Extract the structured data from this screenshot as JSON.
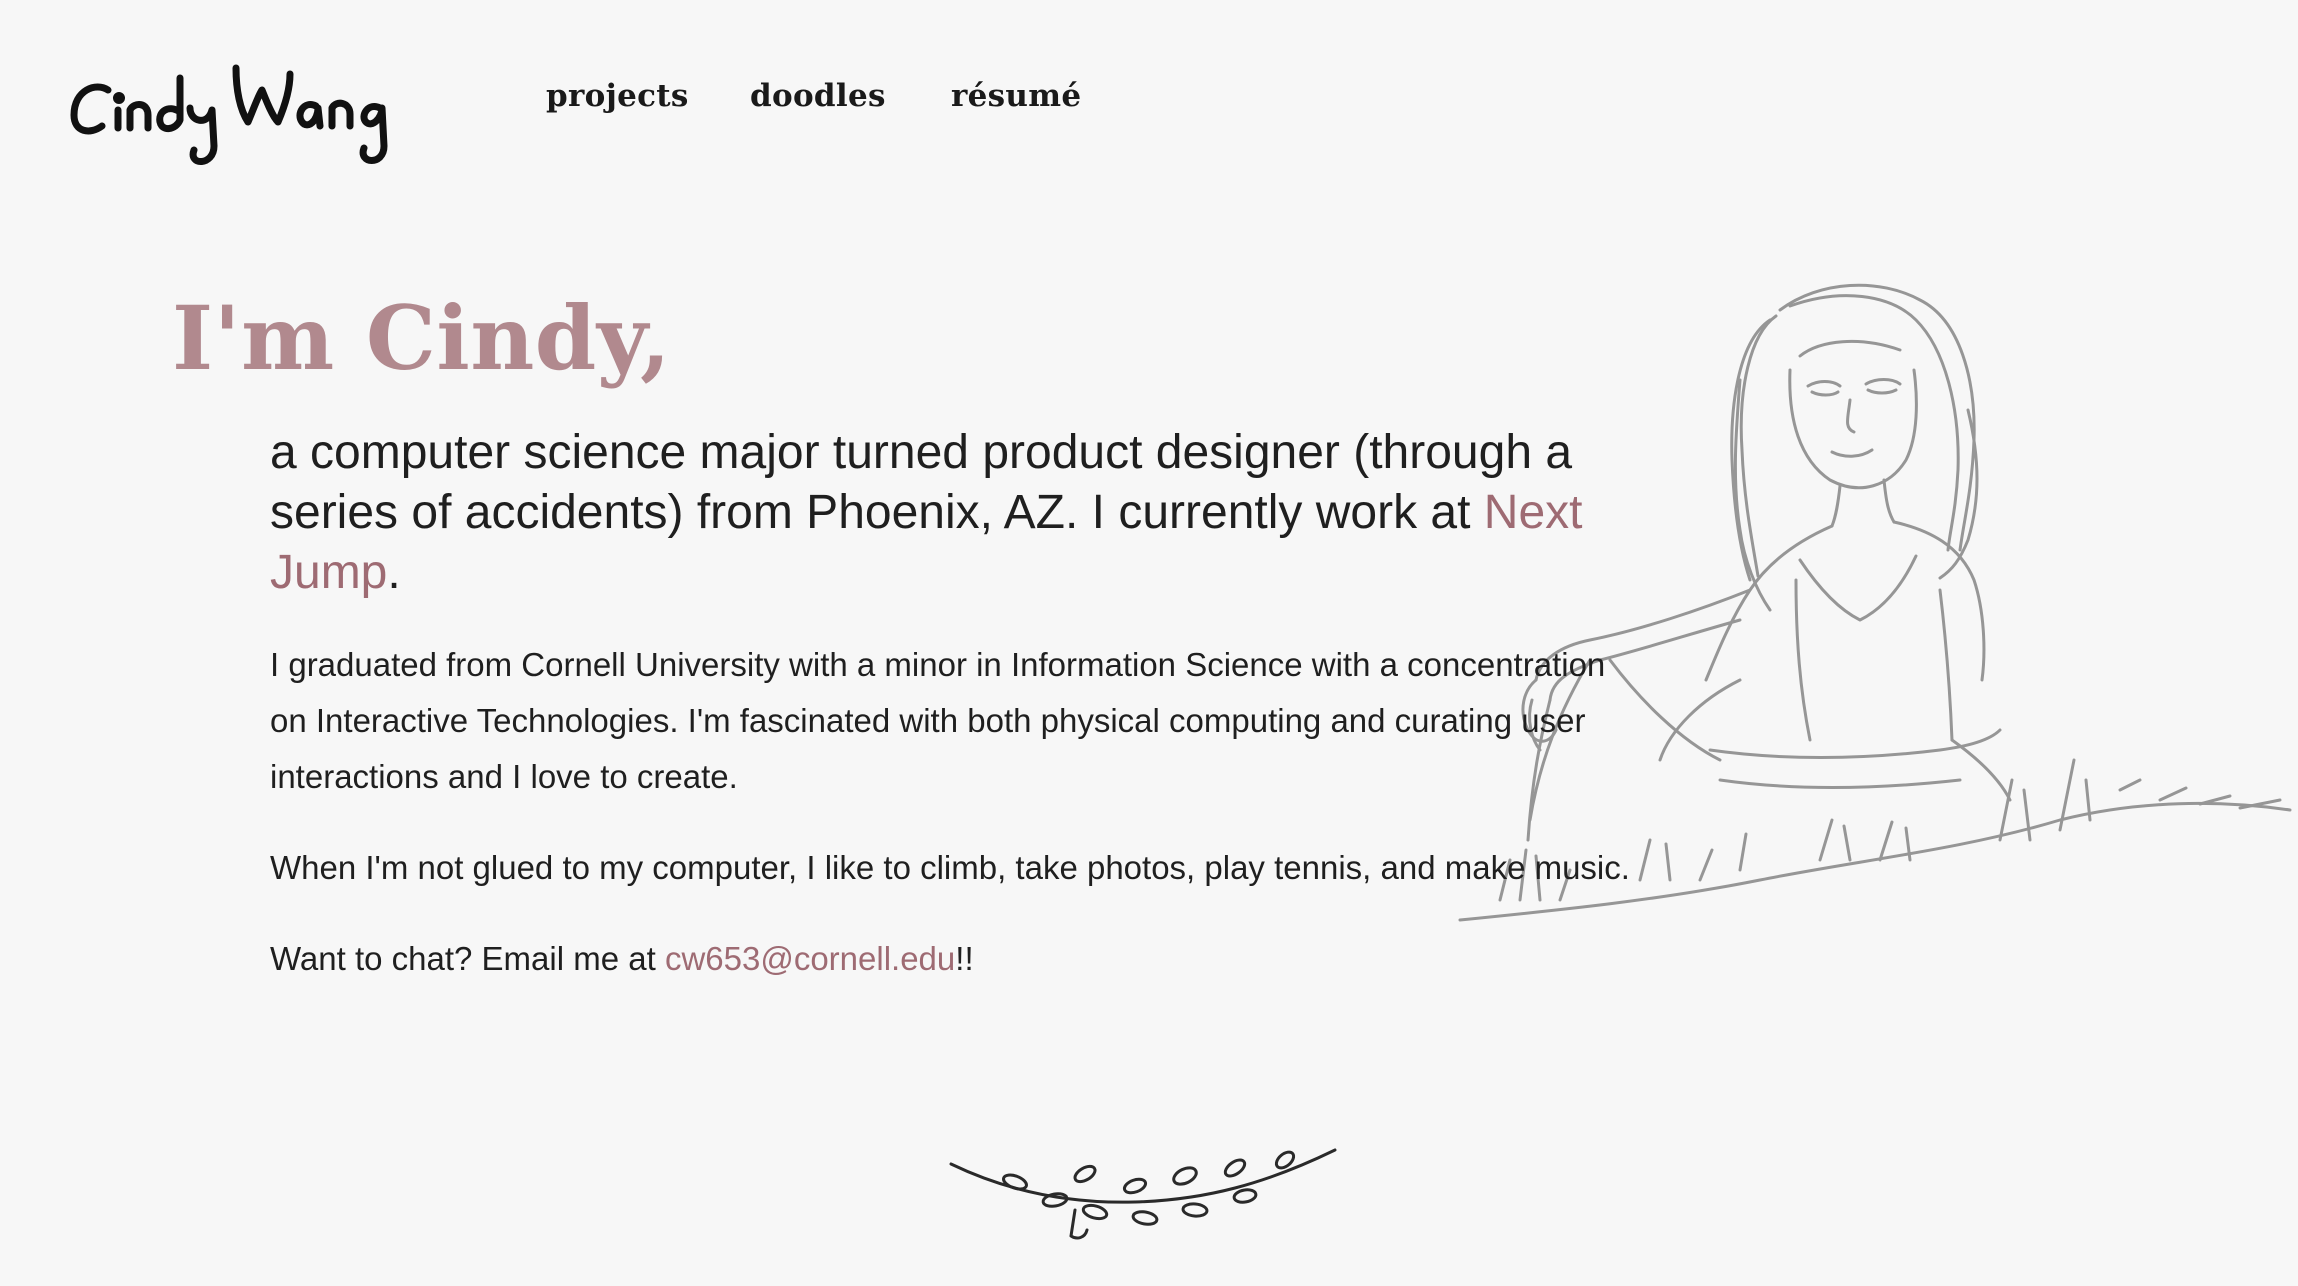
{
  "header": {
    "logo_text": "Cindy Wang",
    "nav": [
      {
        "label": "projects"
      },
      {
        "label": "doodles"
      },
      {
        "label": "résumé"
      }
    ]
  },
  "intro": {
    "greeting": "I'm Cindy,",
    "lead_before": "a computer science major turned product designer (through a series of accidents) from Phoenix, AZ. I currently work at ",
    "lead_link": "Next Jump",
    "lead_after": ".",
    "paragraph_1": "I graduated from Cornell University with a minor in Information Science with a concentration on Interactive Technologies. I'm fascinated with both physical computing and curating user interactions and I love to create.",
    "paragraph_2": "When I'm not glued to my computer, I like to climb, take photos, play tennis, and make music.",
    "paragraph_3_before": "Want to chat? Email me at ",
    "email": "cw653@cornell.edu",
    "paragraph_3_after": "!!"
  },
  "colors": {
    "background": "#f7f7f7",
    "accent": "#b1898e",
    "link": "#9e6b73",
    "text": "#1f1f1f",
    "sketch": "#8a8a8a"
  },
  "icons": {
    "portrait": "girl-sitting-sketch",
    "divider": "leaf-branch-sketch"
  }
}
